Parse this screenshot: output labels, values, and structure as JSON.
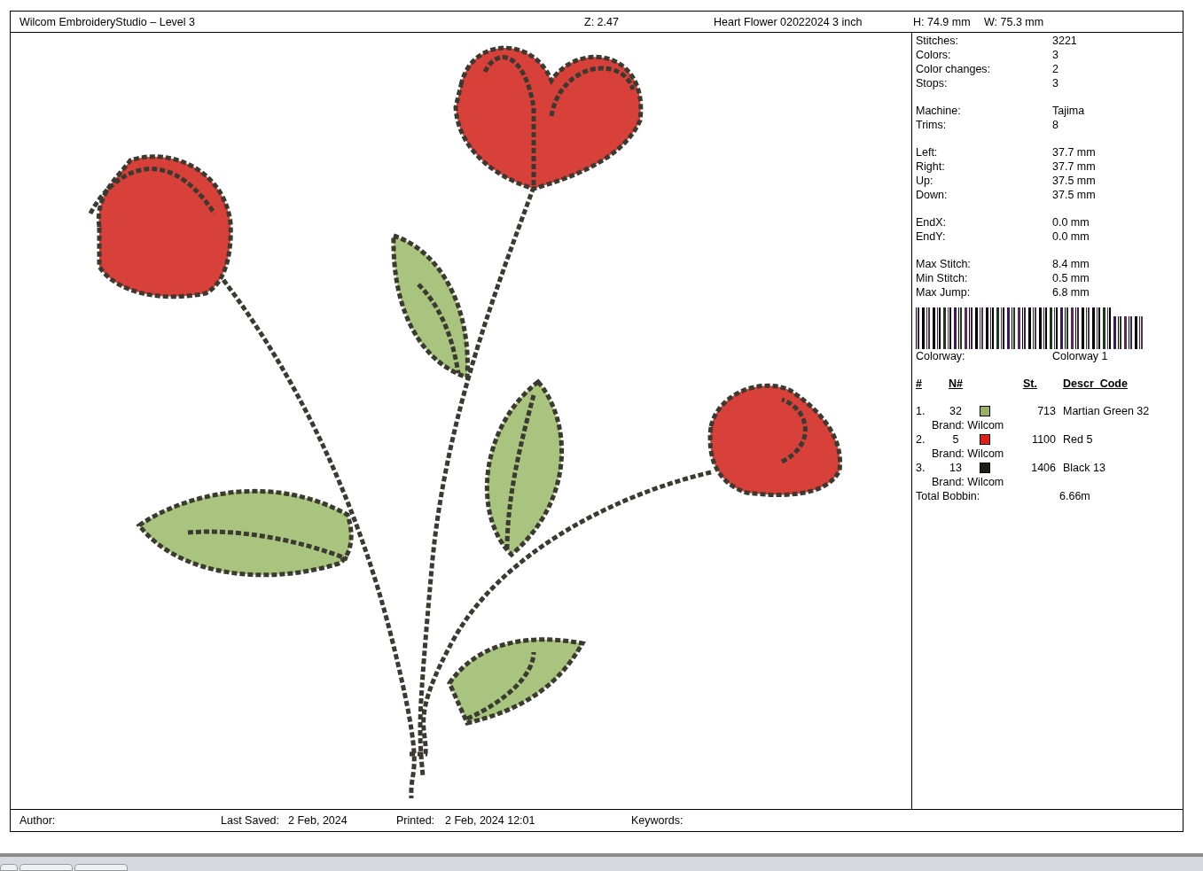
{
  "header": {
    "title": "Wilcom EmbroideryStudio – Level 3",
    "zoom": "Z: 2.47",
    "design_name": "Heart Flower 02022024 3 inch",
    "height": "H: 74.9 mm",
    "width": "W: 75.3 mm"
  },
  "stats": [
    [
      {
        "label": "Stitches:",
        "value": "3221"
      },
      {
        "label": "Colors:",
        "value": "3"
      },
      {
        "label": "Color changes:",
        "value": "2"
      },
      {
        "label": "Stops:",
        "value": "3"
      }
    ],
    [
      {
        "label": "Machine:",
        "value": "Tajima"
      },
      {
        "label": "Trims:",
        "value": "8"
      }
    ],
    [
      {
        "label": "Left:",
        "value": "37.7 mm"
      },
      {
        "label": "Right:",
        "value": "37.7 mm"
      },
      {
        "label": "Up:",
        "value": "37.5 mm"
      },
      {
        "label": "Down:",
        "value": "37.5 mm"
      }
    ],
    [
      {
        "label": "EndX:",
        "value": "0.0 mm"
      },
      {
        "label": "EndY:",
        "value": "0.0 mm"
      }
    ],
    [
      {
        "label": "Max Stitch:",
        "value": "8.4 mm"
      },
      {
        "label": "Min Stitch:",
        "value": "0.5 mm"
      },
      {
        "label": "Max Jump:",
        "value": "6.8 mm"
      }
    ]
  ],
  "colorway": {
    "label": "Colorway:",
    "value": "Colorway 1"
  },
  "color_table": {
    "columns": [
      "#",
      "N#",
      "St.",
      "Descr_Code"
    ],
    "rows": [
      {
        "index": "1.",
        "number": "32",
        "color": "#9aaf6a",
        "stitches": "713",
        "description": "Martian Green 32",
        "brand": "Brand: Wilcom"
      },
      {
        "index": "2.",
        "number": "5",
        "color": "#e01e1e",
        "stitches": "1100",
        "description": "Red 5",
        "brand": "Brand: Wilcom"
      },
      {
        "index": "3.",
        "number": "13",
        "color": "#201c18",
        "stitches": "1406",
        "description": "Black 13",
        "brand": "Brand: Wilcom"
      }
    ]
  },
  "total_bobbin": {
    "label": "Total Bobbin:",
    "value": "6.66m"
  },
  "footer": {
    "author": "Author:",
    "last_saved_label": "Last Saved:",
    "last_saved": "2 Feb, 2024",
    "printed_label": "Printed:",
    "printed": "2 Feb, 2024 12:01",
    "keywords": "Keywords:"
  }
}
